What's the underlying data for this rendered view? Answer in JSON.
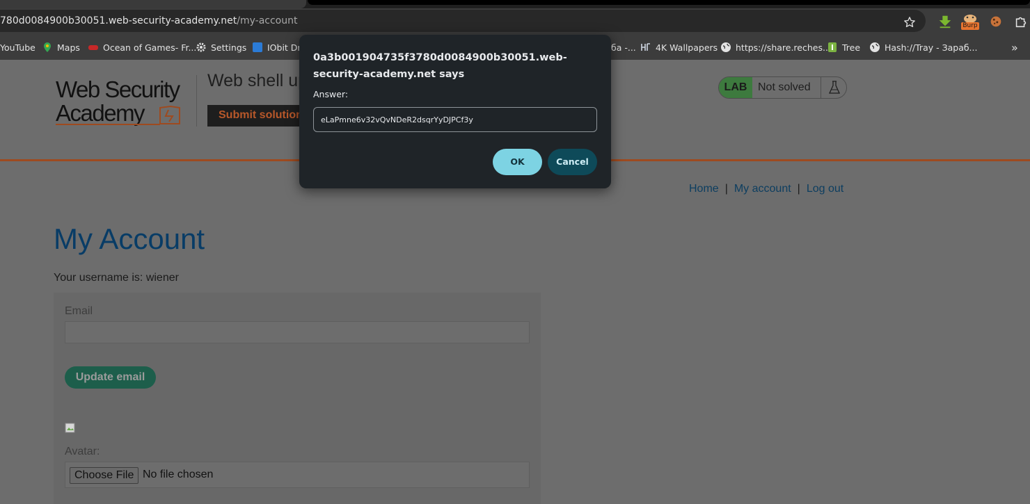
{
  "browser": {
    "url_host": "780d0084900b30051.web-security-academy.net",
    "url_path": "/my-account",
    "extension_burp_label": "Burp",
    "bookmarks": [
      {
        "label": "YouTube",
        "icon": "youtube-icon"
      },
      {
        "label": "Maps",
        "icon": "maps-pin-icon"
      },
      {
        "label": "Ocean of Games- Fr...",
        "icon": "controller-icon"
      },
      {
        "label": "Settings",
        "icon": "gear-icon"
      },
      {
        "label": "IObit Dri",
        "icon": "iobit-icon"
      },
      {
        "label": "ба -...",
        "icon": ""
      },
      {
        "label": "4K Wallpapers",
        "icon": "wallpapers-icon"
      },
      {
        "label": "https://share.reches...",
        "icon": "globe-icon"
      },
      {
        "label": "Tree",
        "icon": "android-icon"
      },
      {
        "label": "Hash://Tray - Зараб...",
        "icon": "globe-icon"
      }
    ],
    "overflow_label": "»"
  },
  "lab": {
    "title": "Web shell up",
    "submit_label": "Submit solution",
    "badge": "LAB",
    "status": "Not solved",
    "status_color": "#3d7a3e"
  },
  "nav": {
    "home": "Home",
    "sep": "|",
    "my_account": "My account",
    "logout": "Log out"
  },
  "account": {
    "heading": "My Account",
    "username_text": "Your username is: wiener",
    "email_label": "Email",
    "email_value": "",
    "update_button": "Update email",
    "avatar_label": "Avatar:",
    "choose_file": "Choose File",
    "no_file": "No file chosen"
  },
  "dialog": {
    "title": "0a3b001904735f3780d0084900b30051.web-security-academy.net says",
    "label": "Answer:",
    "value": "eLaPmne6v32vQvNDeR2dsqrYyDJPCf3y",
    "ok": "OK",
    "cancel": "Cancel"
  }
}
